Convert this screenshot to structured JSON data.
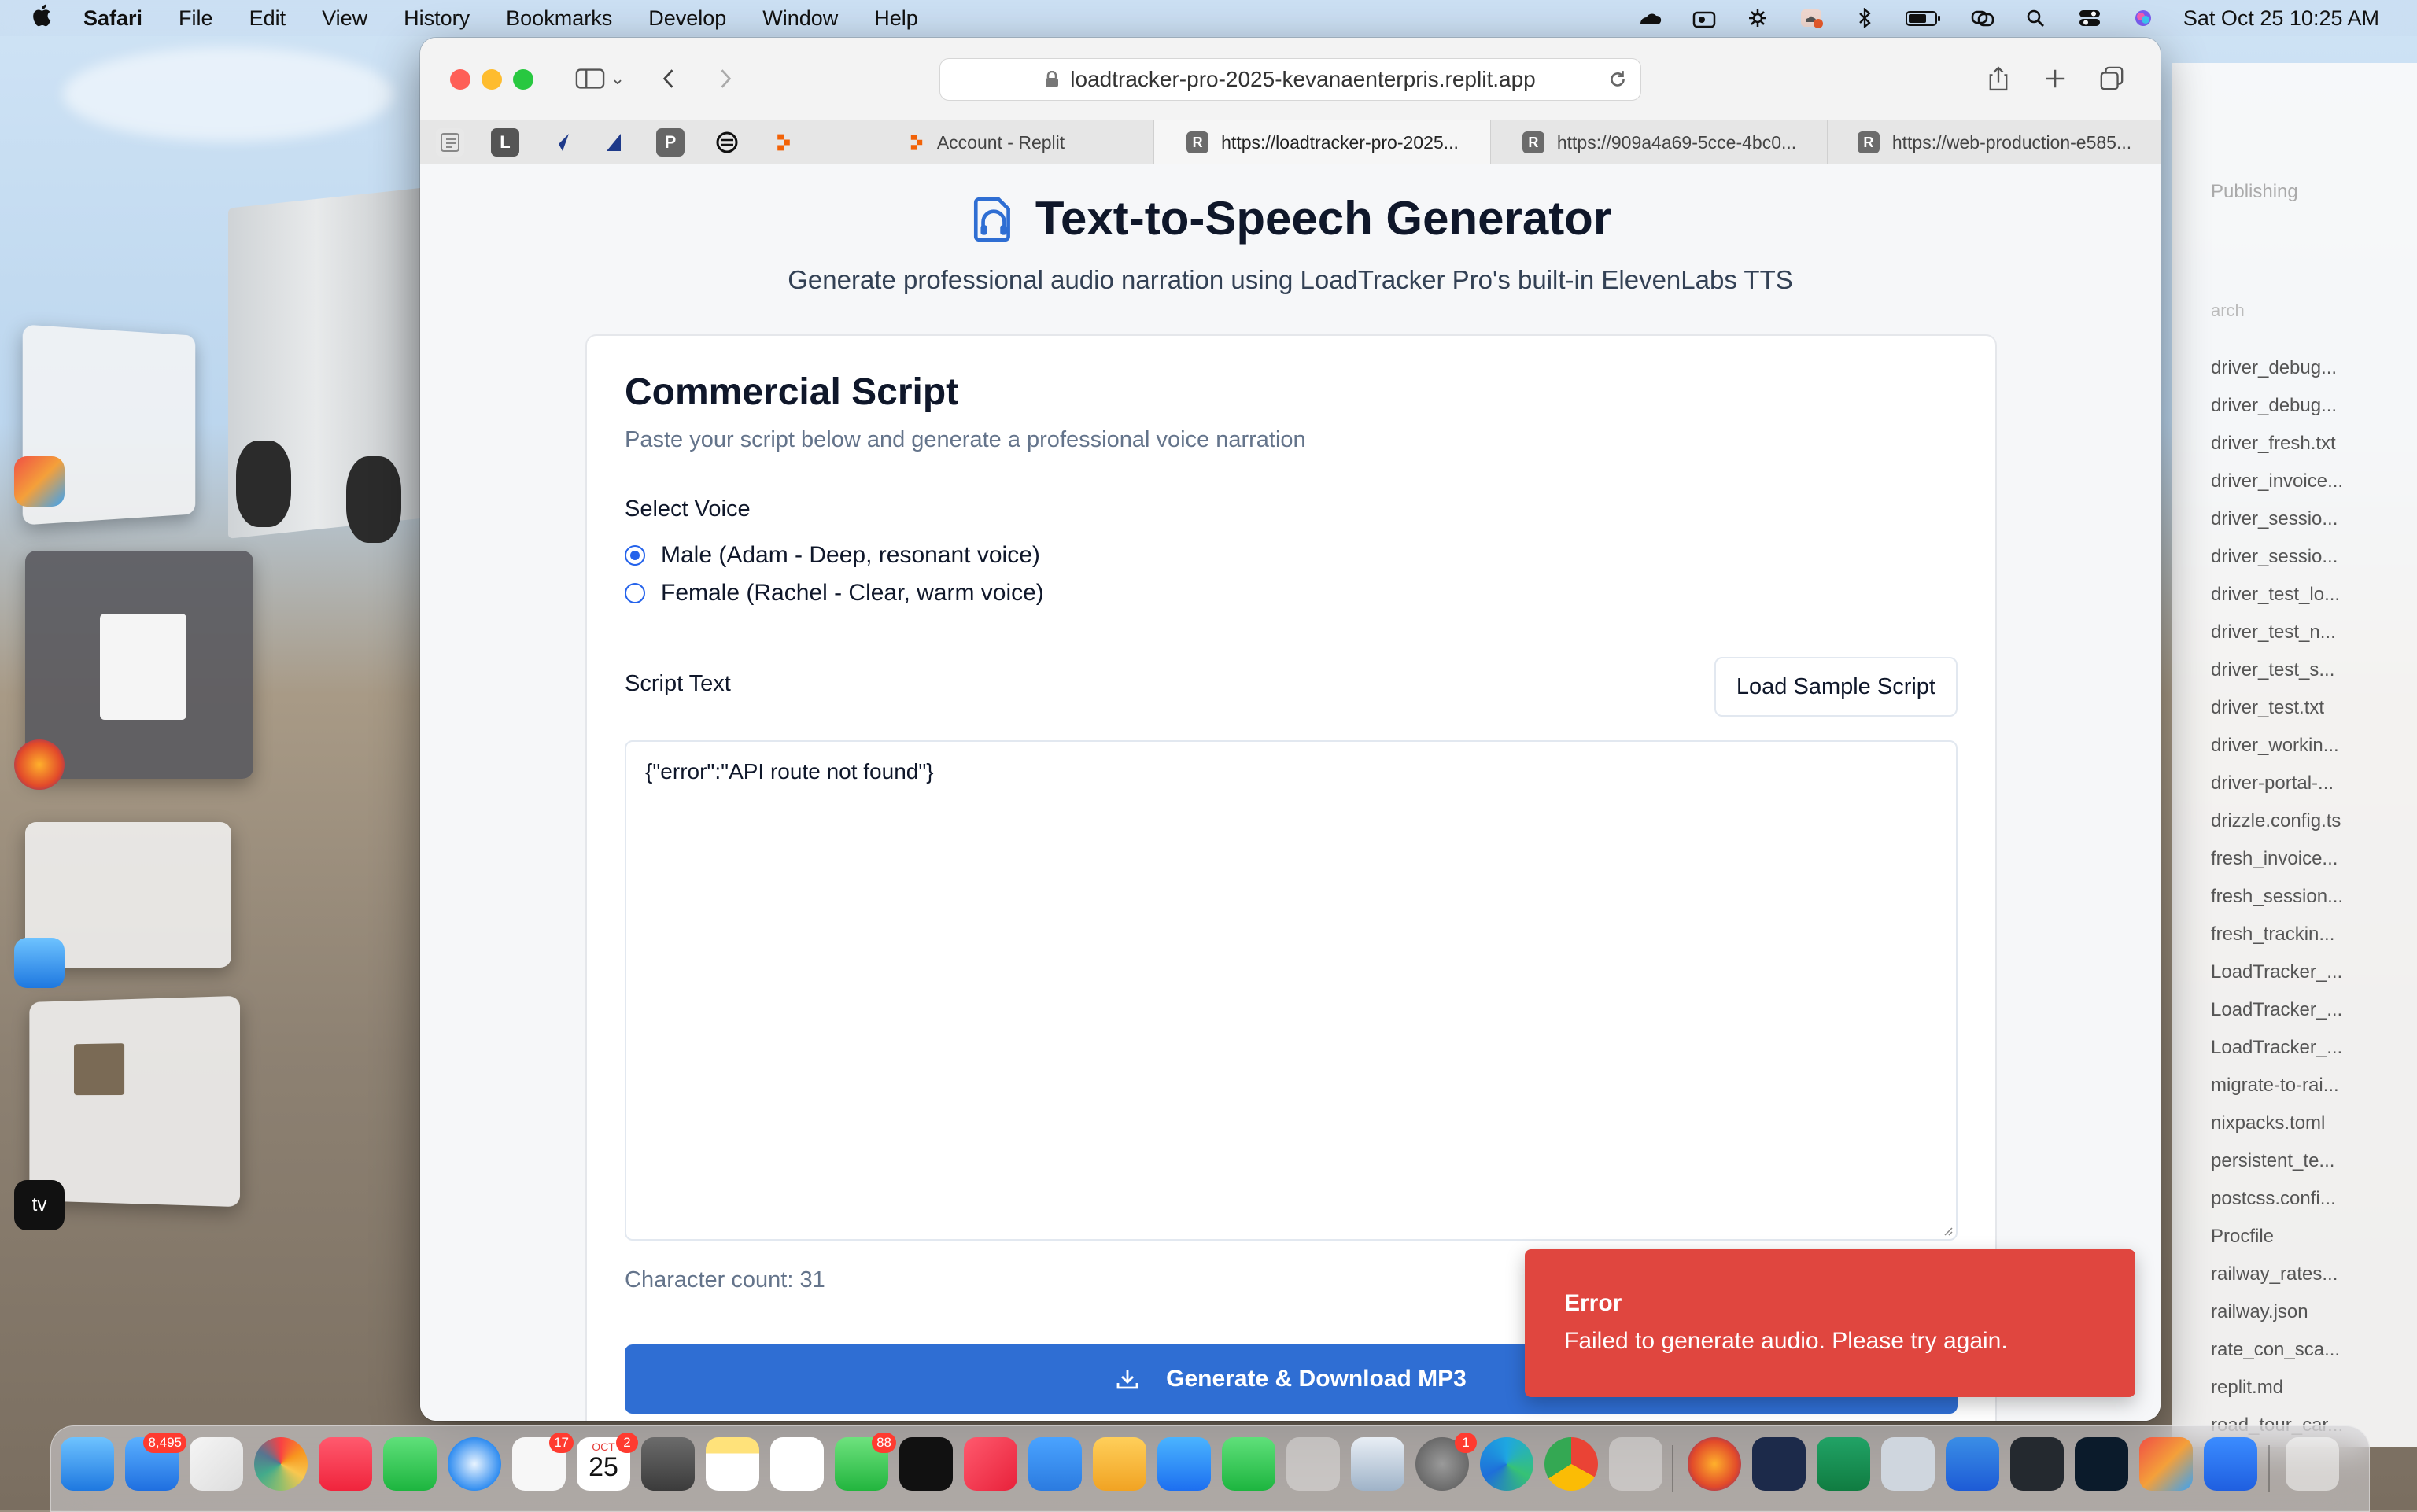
{
  "menubar": {
    "app": "Safari",
    "items": [
      "File",
      "Edit",
      "View",
      "History",
      "Bookmarks",
      "Develop",
      "Window",
      "Help"
    ],
    "clock": "Sat Oct 25  10:25 AM"
  },
  "browser": {
    "url": "loadtracker-pro-2025-kevanaenterpris.replit.app",
    "pinned_tabs": [
      "L",
      "P"
    ],
    "tabs": [
      {
        "label": "Account - Replit",
        "favicon": "replit-logo"
      },
      {
        "label": "https://loadtracker-pro-2025...",
        "favicon": "R"
      },
      {
        "label": "https://909a4a69-5cce-4bc0...",
        "favicon": "R"
      },
      {
        "label": "https://web-production-e585...",
        "favicon": "R"
      }
    ]
  },
  "page": {
    "title": "Text-to-Speech Generator",
    "subtitle": "Generate professional audio narration using LoadTracker Pro's built-in ElevenLabs TTS",
    "card": {
      "title": "Commercial Script",
      "description": "Paste your script below and generate a professional voice narration",
      "voice_label": "Select Voice",
      "voices": [
        {
          "label": "Male (Adam - Deep, resonant voice)",
          "checked": true
        },
        {
          "label": "Female (Rachel - Clear, warm voice)",
          "checked": false
        }
      ],
      "script_label": "Script Text",
      "load_sample": "Load Sample Script",
      "script_value": "{\"error\":\"API route not found\"}",
      "char_count": "Character count: 31",
      "generate_button": "Generate & Download MP3"
    }
  },
  "toast": {
    "title": "Error",
    "message": "Failed to generate audio. Please try again.",
    "color": "#e0463f"
  },
  "background_window": {
    "tab_label": "Publishing",
    "search_placeholder": "arch",
    "files": [
      "driver_debug...",
      "driver_debug...",
      "driver_fresh.txt",
      "driver_invoice...",
      "driver_sessio...",
      "driver_sessio...",
      "driver_test_lo...",
      "driver_test_n...",
      "driver_test_s...",
      "driver_test.txt",
      "driver_workin...",
      "driver-portal-...",
      "drizzle.config.ts",
      "fresh_invoice...",
      "fresh_session...",
      "fresh_trackin...",
      "LoadTracker_...",
      "LoadTracker_...",
      "LoadTracker_...",
      "migrate-to-rai...",
      "nixpacks.toml",
      "persistent_te...",
      "postcss.confi...",
      "Procfile",
      "railway_rates...",
      "railway.json",
      "rate_con_sca...",
      "replit.md",
      "road_tour_car..."
    ]
  },
  "dock": {
    "mail_badge": "8,495",
    "reminders_badge": "17",
    "calendar_month": "OCT",
    "calendar_day": "25",
    "calendar_badge": "2",
    "messages_badge": "88",
    "settings_badge": "1"
  },
  "colors": {
    "accent": "#2f6ed3",
    "radio": "#2563eb",
    "error": "#e0463f"
  }
}
